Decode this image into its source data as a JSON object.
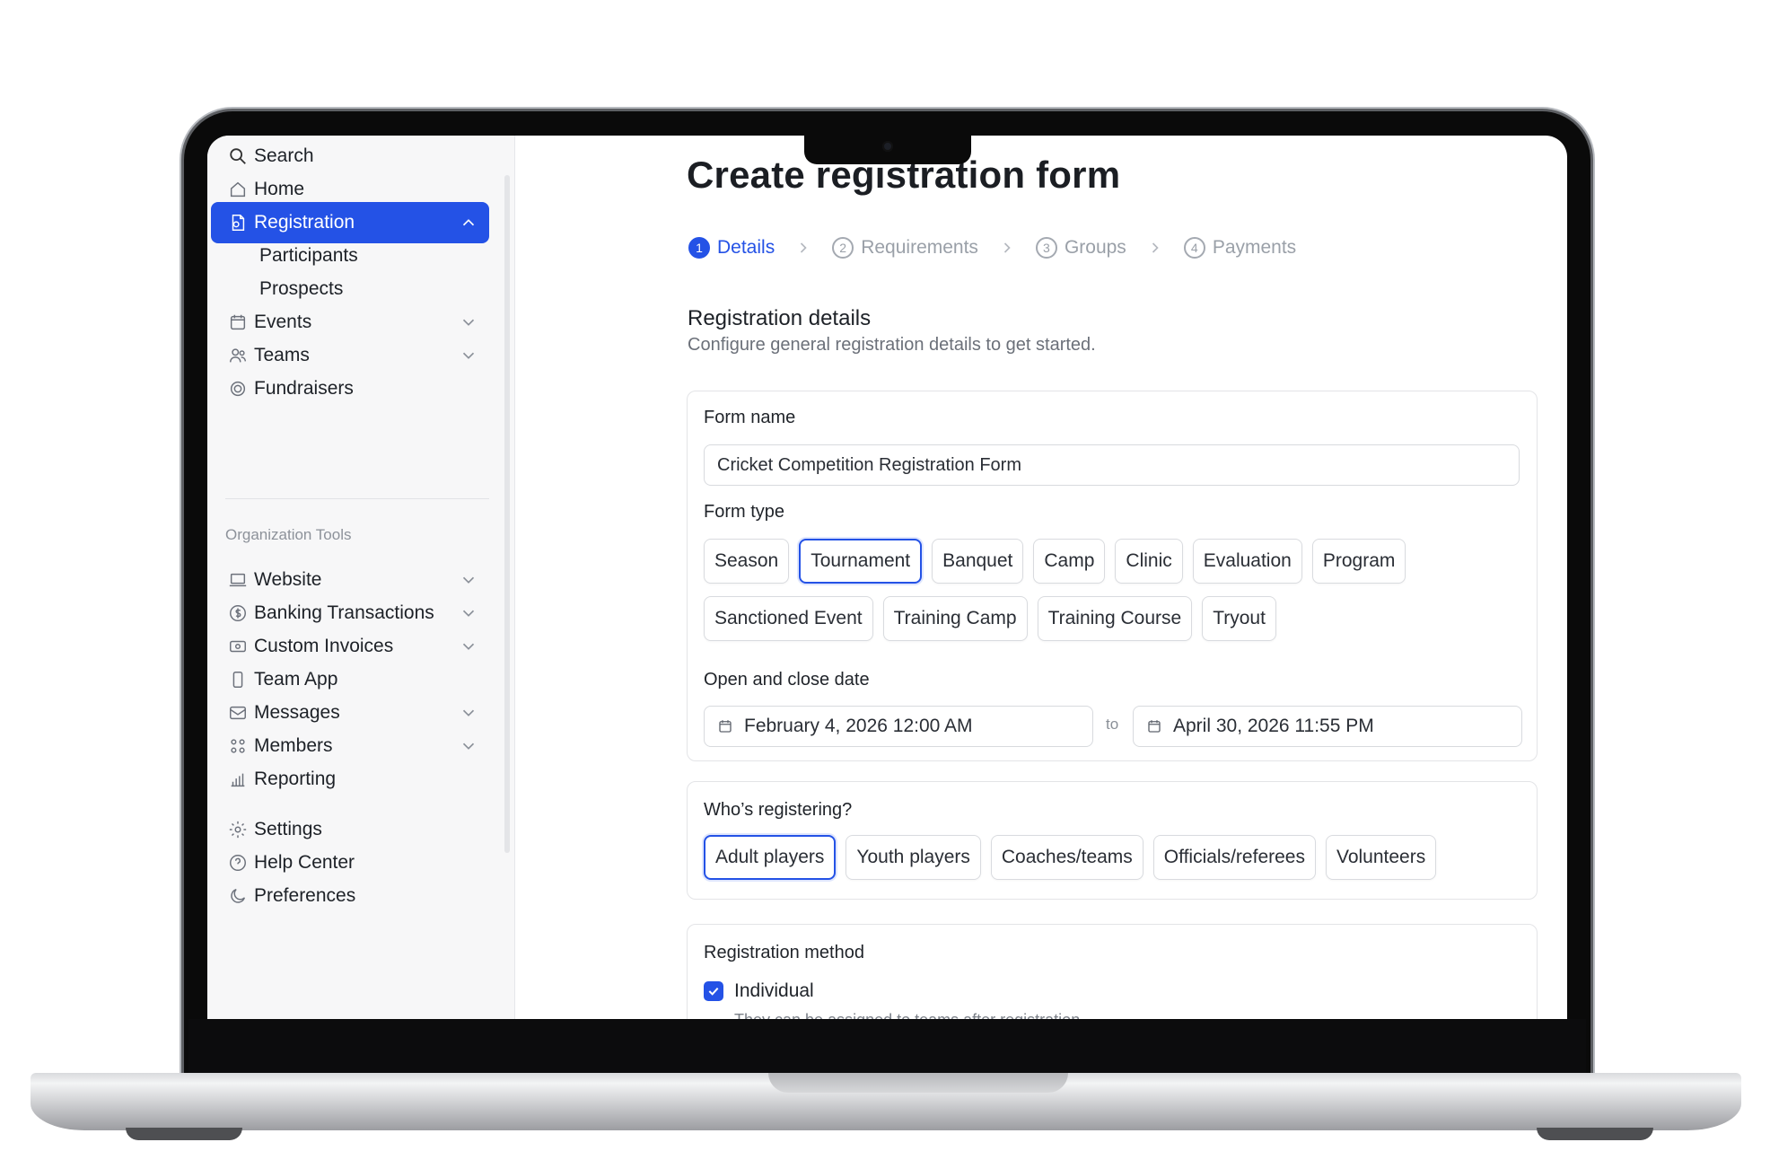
{
  "sidebar": {
    "search_label": "Search",
    "items": [
      {
        "label": "Home",
        "icon": "home-icon"
      },
      {
        "label": "Registration",
        "icon": "registration-icon",
        "active": true,
        "expanded": true
      },
      {
        "label": "Participants"
      },
      {
        "label": "Prospects"
      },
      {
        "label": "Events",
        "icon": "calendar-icon"
      },
      {
        "label": "Teams",
        "icon": "users-icon"
      },
      {
        "label": "Fundraisers",
        "icon": "fundraiser-icon"
      }
    ],
    "section_label": "Organization Tools",
    "tools": [
      {
        "label": "Website",
        "icon": "laptop-icon"
      },
      {
        "label": "Banking Transactions",
        "icon": "dollar-icon"
      },
      {
        "label": "Custom Invoices",
        "icon": "invoice-icon"
      },
      {
        "label": "Team App",
        "icon": "phone-icon"
      },
      {
        "label": "Messages",
        "icon": "mail-icon"
      },
      {
        "label": "Members",
        "icon": "members-icon"
      },
      {
        "label": "Reporting",
        "icon": "bar-chart-icon"
      }
    ],
    "footer": [
      {
        "label": "Settings",
        "icon": "gear-icon"
      },
      {
        "label": "Help Center",
        "icon": "help-icon"
      },
      {
        "label": "Preferences",
        "icon": "moon-icon"
      }
    ]
  },
  "page": {
    "title": "Create registration form",
    "steps": [
      {
        "num": "1",
        "label": "Details",
        "active": true
      },
      {
        "num": "2",
        "label": "Requirements"
      },
      {
        "num": "3",
        "label": "Groups"
      },
      {
        "num": "4",
        "label": "Payments"
      }
    ],
    "section_title": "Registration details",
    "section_subtitle": "Configure general registration details to get started."
  },
  "form": {
    "name_label": "Form name",
    "name_value": "Cricket Competition Registration Form",
    "type_label": "Form type",
    "types_row1": [
      "Season",
      "Tournament",
      "Banquet",
      "Camp",
      "Clinic",
      "Evaluation",
      "Program"
    ],
    "types_row2": [
      "Sanctioned Event",
      "Training Camp",
      "Training Course",
      "Tryout"
    ],
    "type_selected": "Tournament",
    "date_label": "Open and close date",
    "open_date": "February 4, 2026 12:00 AM",
    "date_separator": "to",
    "close_date": "April 30, 2026 11:55 PM",
    "who_label": "Who’s registering?",
    "who_options": [
      "Adult players",
      "Youth players",
      "Coaches/teams",
      "Officials/referees",
      "Volunteers"
    ],
    "who_selected": "Adult players",
    "method_label": "Registration method",
    "method_option": "Individual",
    "method_help": "They can be assigned to teams after registration."
  },
  "colors": {
    "accent": "#2452e6",
    "sidebar_bg": "#f7f7f8",
    "border": "#e3e4e7"
  }
}
